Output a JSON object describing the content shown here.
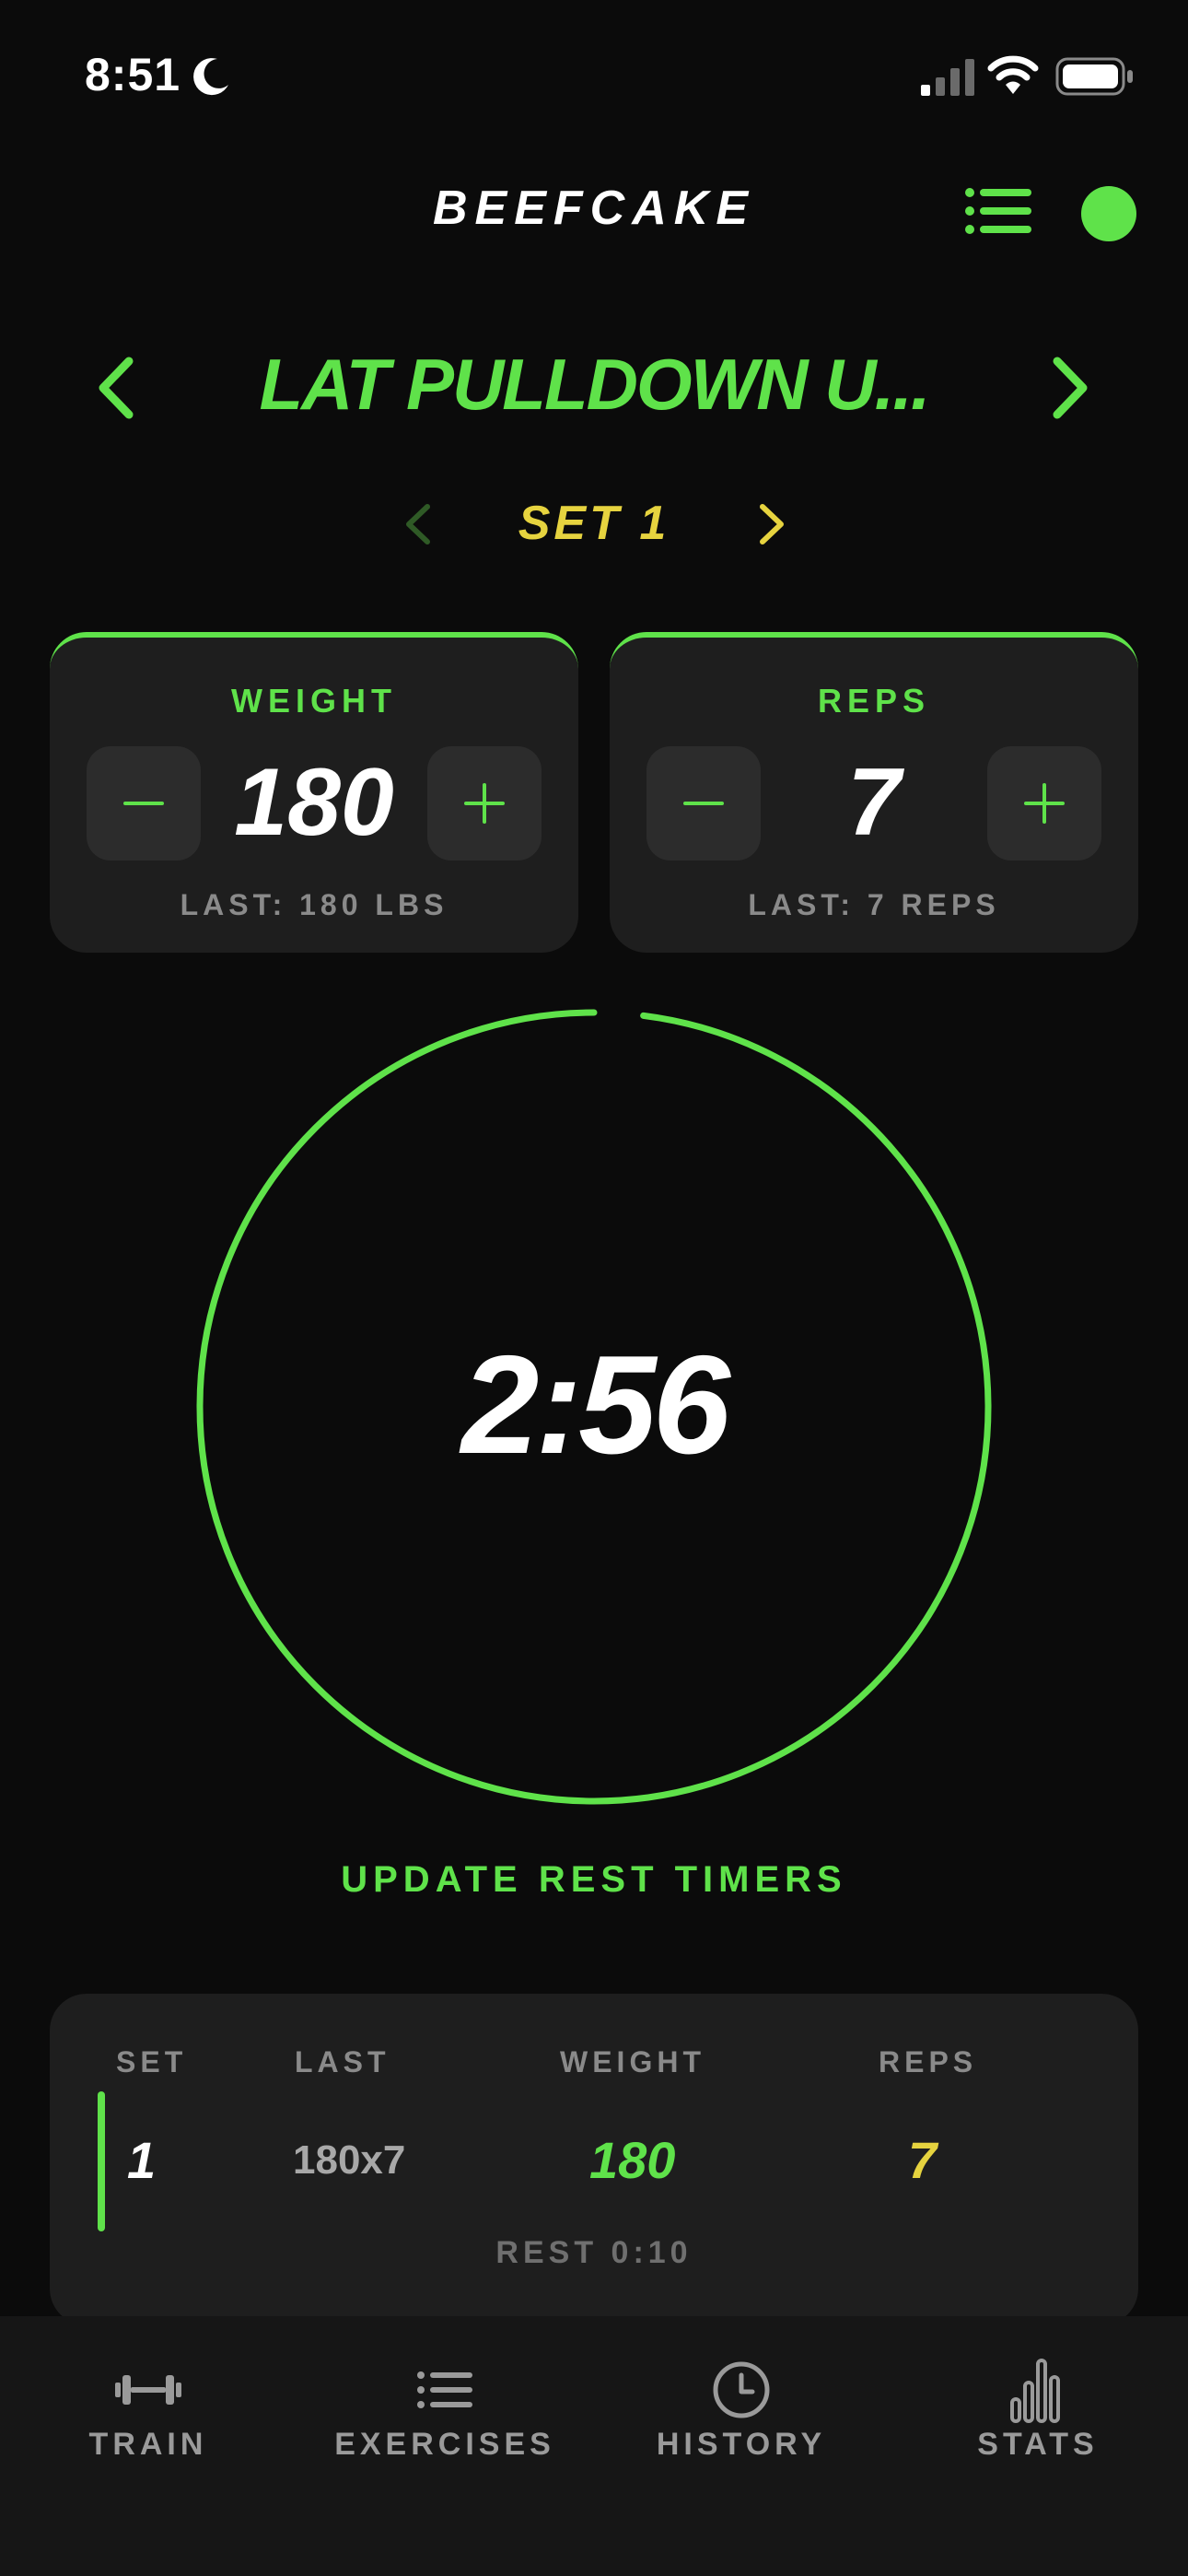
{
  "status_bar": {
    "time": "8:51"
  },
  "header": {
    "brand": "BEEFCAKE"
  },
  "exercise": {
    "title": "LAT PULLDOWN U..."
  },
  "set_nav": {
    "label": "SET 1"
  },
  "weight_card": {
    "title": "WEIGHT",
    "value": "180",
    "last": "LAST: 180 LBS"
  },
  "reps_card": {
    "title": "REPS",
    "value": "7",
    "last": "LAST: 7 REPS"
  },
  "timer": {
    "display": "2:56",
    "progress": 0.98
  },
  "update_rest_label": "UPDATE REST TIMERS",
  "set_table": {
    "headers": [
      "SET",
      "LAST",
      "WEIGHT",
      "REPS"
    ],
    "rows": [
      {
        "set": "1",
        "last": "180x7",
        "weight": "180",
        "reps": "7"
      }
    ],
    "rest": "REST 0:10"
  },
  "tabs": [
    {
      "label": "TRAIN",
      "icon": "dumbbell-icon"
    },
    {
      "label": "EXERCISES",
      "icon": "list-icon"
    },
    {
      "label": "HISTORY",
      "icon": "clock-icon"
    },
    {
      "label": "STATS",
      "icon": "bar-chart-icon"
    }
  ],
  "colors": {
    "accent": "#5fe24a",
    "highlight": "#e6d33f",
    "background": "#0b0b0b",
    "card": "#1e1e1e"
  }
}
